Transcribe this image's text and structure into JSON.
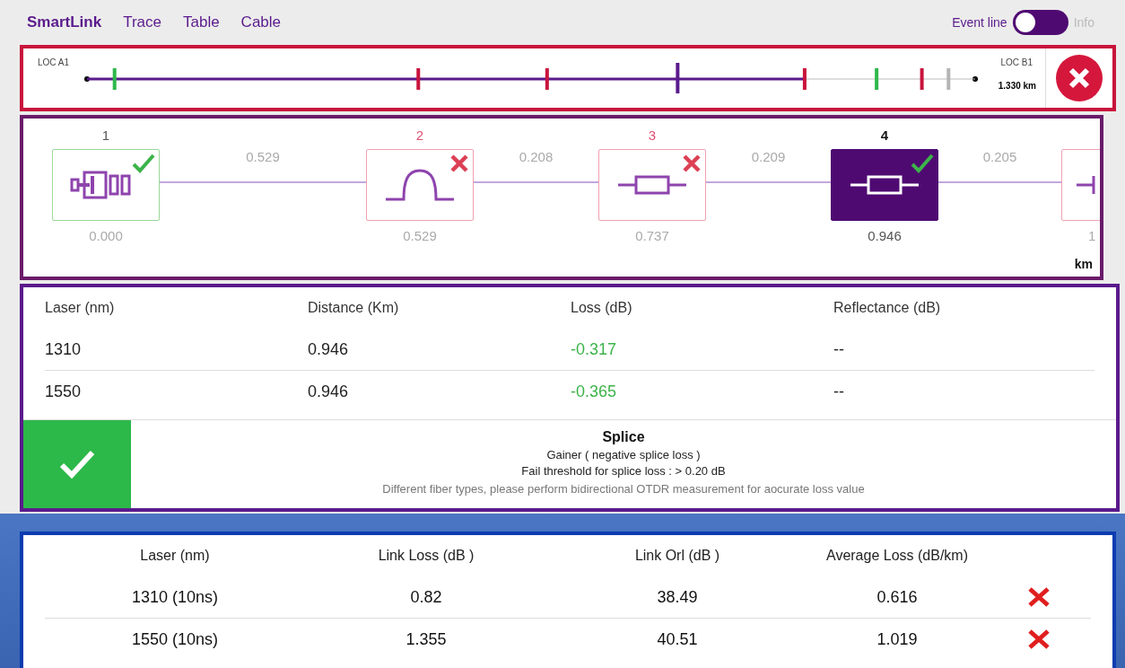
{
  "tabs": [
    {
      "label": "SmartLink",
      "selected": true
    },
    {
      "label": "Trace",
      "selected": false
    },
    {
      "label": "Table",
      "selected": false
    },
    {
      "label": "Cable",
      "selected": false
    }
  ],
  "view_switch": [
    {
      "label": "Event line",
      "selected": true
    },
    {
      "label": "Info",
      "selected": false
    }
  ],
  "link_map": {
    "start": "LOC A1",
    "end": "LOC B1",
    "length": "1.330 km",
    "markers": [
      {
        "color": "#2db84a"
      },
      {
        "color": "#c8143c"
      },
      {
        "color": "#c8143c"
      },
      {
        "color": "#5a1a8c"
      },
      {
        "color": "#c8143c"
      },
      {
        "color": "#2db84a"
      },
      {
        "color": "#c8143c"
      },
      {
        "color": "#b4b4b4"
      }
    ]
  },
  "events": [
    {
      "number": "1",
      "kind": "connector",
      "passed": true,
      "selected": false,
      "distance": "0.000",
      "span": "0.529"
    },
    {
      "number": "2",
      "kind": "reflective",
      "passed": false,
      "selected": false,
      "distance": "0.529",
      "span": "0.208"
    },
    {
      "number": "3",
      "kind": "splice",
      "passed": false,
      "selected": false,
      "distance": "0.737",
      "span": "0.209"
    },
    {
      "number": "4",
      "kind": "splice",
      "passed": true,
      "selected": true,
      "distance": "0.946",
      "span": "0.205"
    },
    {
      "kind": "end",
      "passed": false,
      "selected": false,
      "distance": "1"
    }
  ],
  "unit": "km",
  "event_table": {
    "columns": [
      "Laser (nm)",
      "Distance (Km)",
      "Loss (dB)",
      "Reflectance (dB)"
    ],
    "rows": [
      {
        "laser": "1310",
        "distance": "0.946",
        "loss": "-0.317",
        "pass": true,
        "reflectance": "--"
      },
      {
        "laser": "1550",
        "distance": "0.946",
        "loss": "-0.365",
        "pass": true,
        "reflectance": "--"
      }
    ]
  },
  "verdict": {
    "pass": true,
    "title": "Splice",
    "lines": [
      "Gainer ( negative splice loss )",
      "Fail threshold for splice loss : > 0.20 dB"
    ],
    "note": "Different fiber types, please perform bidirectional OTDR measurement for aocurate loss value"
  },
  "summary": {
    "columns": [
      "Laser (nm)",
      "Link Loss (dB )",
      "Link Orl (dB )",
      "Average Loss (dB/km)"
    ],
    "rows": [
      {
        "laser": "1310 (10ns)",
        "link_loss": "0.82",
        "link_orl": "38.49",
        "average_loss": "0.616",
        "pass": false
      },
      {
        "laser": "1550 (10ns)",
        "link_loss": "1.355",
        "link_orl": "40.51",
        "average_loss": "1.019",
        "pass": false
      }
    ]
  }
}
